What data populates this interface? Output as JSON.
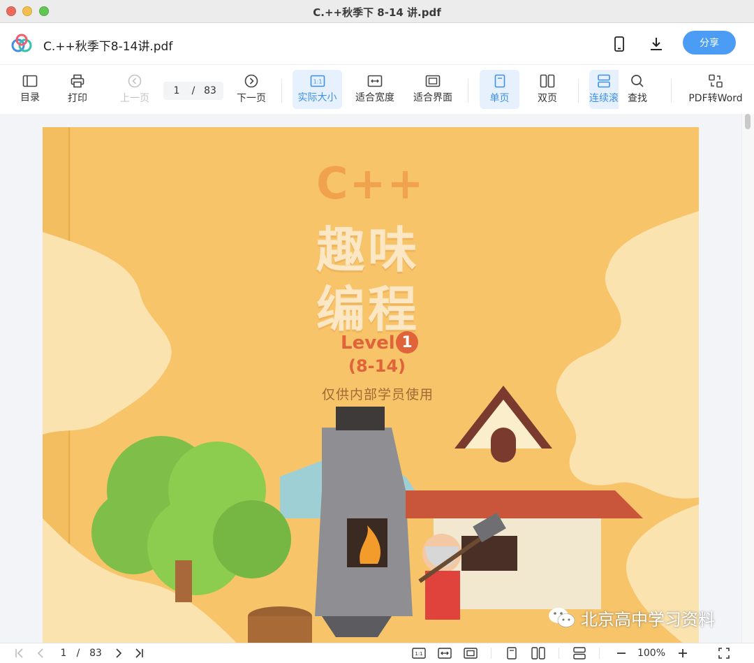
{
  "window": {
    "title": "C.++秋季下 8-14 讲.pdf"
  },
  "header": {
    "doc_title": "C.++秋季下8-14讲.pdf",
    "share_label": "分享"
  },
  "toolbar": {
    "toc": "目录",
    "print": "打印",
    "prev_page": "上一页",
    "current_page": "1",
    "page_sep": "/",
    "total_pages": "83",
    "next_page": "下一页",
    "actual_size": "实际大小",
    "fit_width": "适合宽度",
    "fit_window": "适合界面",
    "single_page": "单页",
    "double_page": "双页",
    "continuous": "连续滚",
    "find": "查找",
    "pdf_to_word": "PDF转Word"
  },
  "cover": {
    "title_line1": "C++",
    "title_line2": "趣味",
    "title_line3": "编程",
    "level": "Level",
    "level_num": "1",
    "range": "(8-14)",
    "note": "仅供内部学员使用"
  },
  "watermark": "北京高中学习资料",
  "bottombar": {
    "current_page": "1",
    "page_sep": "/",
    "total_pages": "83",
    "zoom": "100%"
  },
  "colors": {
    "accent": "#4a9cf5",
    "cover_bg": "#f7c46a",
    "cover_title": "#fbe7c4",
    "cover_subtitle": "#e0633a"
  }
}
